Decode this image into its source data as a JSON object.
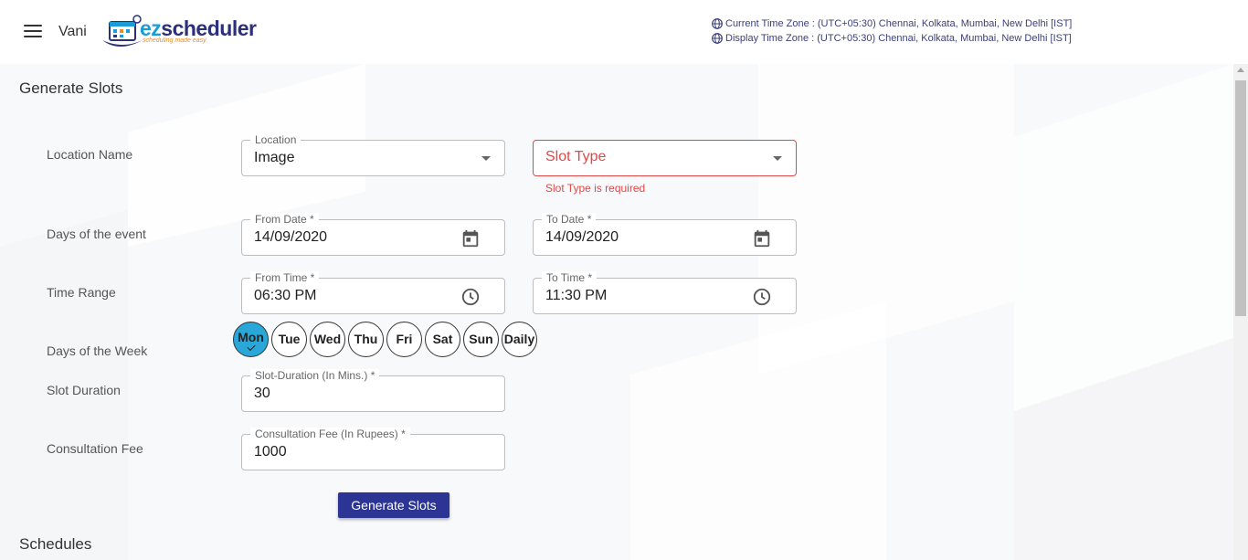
{
  "header": {
    "username": "Vani",
    "logo_ez": "ez",
    "logo_rest": "scheduler",
    "logo_tagline": "scheduling made easy",
    "current_tz": "Current Time Zone : (UTC+05:30) Chennai, Kolkata, Mumbai, New Delhi [IST]",
    "display_tz": "Display Time Zone : (UTC+05:30) Chennai, Kolkata, Mumbai, New Delhi [IST]"
  },
  "generate": {
    "title": "Generate Slots",
    "labels": {
      "location": "Location Name",
      "days_event": "Days of the event",
      "time_range": "Time Range",
      "days_week": "Days of the Week",
      "slot_duration": "Slot Duration",
      "consult_fee": "Consultation Fee"
    },
    "location": {
      "label": "Location",
      "value": "Image"
    },
    "slot_type": {
      "placeholder": "Slot Type",
      "error": "Slot Type is required"
    },
    "from_date": {
      "label": "From Date *",
      "value": "14/09/2020"
    },
    "to_date": {
      "label": "To Date *",
      "value": "14/09/2020"
    },
    "from_time": {
      "label": "From Time *",
      "value": "06:30 PM"
    },
    "to_time": {
      "label": "To Time *",
      "value": "11:30 PM"
    },
    "days": [
      "Mon",
      "Tue",
      "Wed",
      "Thu",
      "Fri",
      "Sat",
      "Sun",
      "Daily"
    ],
    "selected_day": "Mon",
    "slot_duration": {
      "label": "Slot-Duration (In Mins.) *",
      "value": "30"
    },
    "consult_fee": {
      "label": "Consultation Fee (In Rupees) *",
      "value": "1000"
    },
    "button": "Generate Slots"
  },
  "schedules": {
    "title": "Schedules"
  },
  "colors": {
    "accent": "#2aa7d9",
    "primary_button": "#2c3593",
    "error": "#e04848"
  }
}
